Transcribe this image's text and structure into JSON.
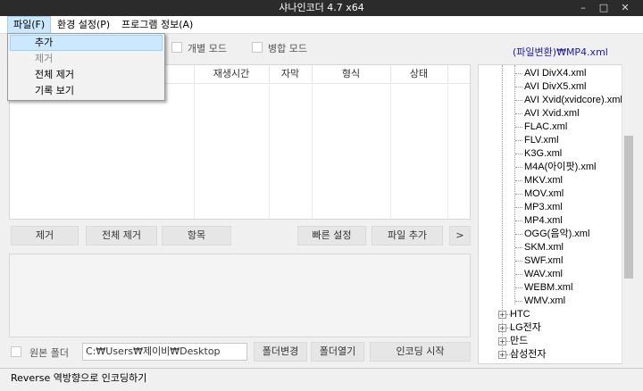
{
  "window": {
    "title": "샤나인코더 4.7 x64",
    "minimize": "–",
    "maximize": "□",
    "close": "✕"
  },
  "menu": {
    "file": "파일(F)",
    "settings": "환경 설정(P)",
    "about": "프로그램 정보(A)"
  },
  "file_menu": {
    "items": [
      "추가",
      "제거",
      "전체 제거",
      "기록 보기"
    ],
    "highlighted": 0,
    "disabled": [
      1
    ]
  },
  "modes": {
    "individual": "개별 모드",
    "merge": "병합 모드"
  },
  "preset_label": "(파일변환)₩MP4.xml",
  "table": {
    "columns": [
      "",
      "재생시간",
      "자막",
      "형식",
      "상태"
    ],
    "rows": []
  },
  "buttons": {
    "remove": "제거",
    "remove_all": "전체 제거",
    "item": "항목",
    "quick_settings": "빠른 설정",
    "add_file": "파일 추가",
    "more": ">"
  },
  "bottom": {
    "source_folder_label": "원본 폴더",
    "path": "C:₩Users₩제이비₩Desktop",
    "change_folder": "폴더변경",
    "open_folder": "폴더열기",
    "start_encoding": "인코딩 시작"
  },
  "status": "Reverse 역방향으로 인코딩하기",
  "tree": {
    "files": [
      "AVI DivX4.xml",
      "AVI DivX5.xml",
      "AVI Xvid(xvidcore).xml",
      "AVI Xvid.xml",
      "FLAC.xml",
      "FLV.xml",
      "K3G.xml",
      "M4A(아이팟).xml",
      "MKV.xml",
      "MOV.xml",
      "MP3.xml",
      "MP4.xml",
      "OGG(음악).xml",
      "SKM.xml",
      "SWF.xml",
      "WAV.xml",
      "WEBM.xml",
      "WMV.xml"
    ],
    "folders": [
      "HTC",
      "LG전자",
      "만드",
      "삼성전자"
    ]
  }
}
